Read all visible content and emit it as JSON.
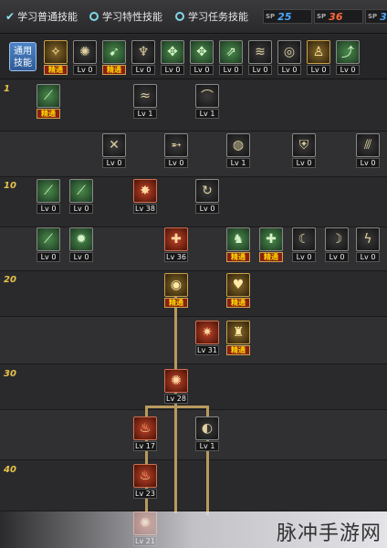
{
  "tabs": [
    {
      "label": "学习普通技能",
      "selected": true
    },
    {
      "label": "学习特性技能",
      "selected": false
    },
    {
      "label": "学习任务技能",
      "selected": false
    }
  ],
  "points": [
    {
      "label": "SP",
      "value": "25",
      "color": "#4aa8ff"
    },
    {
      "label": "SP",
      "value": "36",
      "color": "#ff6a3a"
    },
    {
      "label": "SP",
      "value": "39",
      "color": "#4aa8ff"
    }
  ],
  "common_label": "通用技能",
  "level_markers": [
    "1",
    "10",
    "20",
    "30",
    "40"
  ],
  "common_skills": [
    {
      "icon": "pray-icon",
      "glyph": "✧",
      "color": "gold",
      "label": "精通",
      "master": true
    },
    {
      "icon": "rage-icon",
      "glyph": "✺",
      "color": "dark",
      "label": "Lv 0",
      "master": false
    },
    {
      "icon": "run-icon",
      "glyph": "➹",
      "color": "green",
      "label": "精通",
      "master": true
    },
    {
      "icon": "wing-icon",
      "glyph": "♆",
      "color": "dark",
      "label": "Lv 0",
      "master": false
    },
    {
      "icon": "emblem-icon",
      "glyph": "✥",
      "color": "green",
      "label": "Lv 0",
      "master": false
    },
    {
      "icon": "emblem-icon",
      "glyph": "✥",
      "color": "green",
      "label": "Lv 0",
      "master": false
    },
    {
      "icon": "leap-icon",
      "glyph": "⇗",
      "color": "green",
      "label": "Lv 0",
      "master": false
    },
    {
      "icon": "dash-icon",
      "glyph": "≋",
      "color": "dark",
      "label": "Lv 0",
      "master": false
    },
    {
      "icon": "shield-icon",
      "glyph": "◎",
      "color": "dark",
      "label": "Lv 0",
      "master": false
    },
    {
      "icon": "figure-icon",
      "glyph": "♙",
      "color": "gold",
      "label": "Lv 0",
      "master": false
    },
    {
      "icon": "dodge-icon",
      "glyph": "⤴",
      "color": "green",
      "label": "Lv 0",
      "master": false
    }
  ],
  "skills": [
    {
      "icon": "spear-icon",
      "glyph": "⟋",
      "color": "green",
      "label": "精通",
      "master": true
    },
    {
      "icon": "claw-icon",
      "glyph": "≈",
      "color": "dark",
      "label": "Lv 1",
      "master": false
    },
    {
      "icon": "slash-icon",
      "glyph": "⌒",
      "color": "dark",
      "label": "Lv 1",
      "master": false
    },
    {
      "icon": "cross-slash-icon",
      "glyph": "✕",
      "color": "dark",
      "label": "Lv 0",
      "master": false
    },
    {
      "icon": "arrow-icon",
      "glyph": "➵",
      "color": "dark",
      "label": "Lv 0",
      "master": false
    },
    {
      "icon": "spiral-icon",
      "glyph": "◍",
      "color": "dark",
      "label": "Lv 1",
      "master": false
    },
    {
      "icon": "guard-icon",
      "glyph": "⛨",
      "color": "dark",
      "label": "Lv 0",
      "master": false
    },
    {
      "icon": "triple-slash-icon",
      "glyph": "⫻",
      "color": "dark",
      "label": "Lv 0",
      "master": false
    },
    {
      "icon": "sword-icon",
      "glyph": "⟋",
      "color": "green",
      "label": "Lv 0",
      "master": false
    },
    {
      "icon": "blade-icon",
      "glyph": "⟋",
      "color": "green",
      "label": "Lv 0",
      "master": false
    },
    {
      "icon": "burst-icon",
      "glyph": "✸",
      "color": "red",
      "label": "Lv 38",
      "master": false
    },
    {
      "icon": "swirl-icon",
      "glyph": "↻",
      "color": "dark",
      "label": "Lv 0",
      "master": false
    },
    {
      "icon": "sword-icon",
      "glyph": "⟋",
      "color": "green",
      "label": "Lv 0",
      "master": false
    },
    {
      "icon": "spark-icon",
      "glyph": "✹",
      "color": "green",
      "label": "Lv 0",
      "master": false
    },
    {
      "icon": "strike-icon",
      "glyph": "✚",
      "color": "red",
      "label": "Lv 36",
      "master": false
    },
    {
      "icon": "warrior-icon",
      "glyph": "♞",
      "color": "green",
      "label": "精通",
      "master": true
    },
    {
      "icon": "cross-icon",
      "glyph": "✚",
      "color": "green",
      "label": "精通",
      "master": true
    },
    {
      "icon": "crescent-icon",
      "glyph": "☾",
      "color": "dark",
      "label": "Lv 0",
      "master": false
    },
    {
      "icon": "crescent-icon",
      "glyph": "☽",
      "color": "dark",
      "label": "Lv 0",
      "master": false
    },
    {
      "icon": "lightning-icon",
      "glyph": "ϟ",
      "color": "dark",
      "label": "Lv 0",
      "master": false
    },
    {
      "icon": "shield-icon",
      "glyph": "◉",
      "color": "gold",
      "label": "精通",
      "master": true
    },
    {
      "icon": "heart-icon",
      "glyph": "♥",
      "color": "gold",
      "label": "精通",
      "master": true
    },
    {
      "icon": "impact-icon",
      "glyph": "✷",
      "color": "red",
      "label": "Lv 31",
      "master": false
    },
    {
      "icon": "knight-icon",
      "glyph": "♜",
      "color": "gold",
      "label": "精通",
      "master": true
    },
    {
      "icon": "explosion-icon",
      "glyph": "✺",
      "color": "red",
      "label": "Lv 28",
      "master": false
    },
    {
      "icon": "flame-icon",
      "glyph": "♨",
      "color": "red",
      "label": "Lv 17",
      "master": false
    },
    {
      "icon": "wave-icon",
      "glyph": "◐",
      "color": "dark",
      "label": "Lv 1",
      "master": false
    },
    {
      "icon": "fire-icon",
      "glyph": "♨",
      "color": "red",
      "label": "Lv 23",
      "master": false
    },
    {
      "icon": "blast-icon",
      "glyph": "✺",
      "color": "red",
      "label": "Lv 21",
      "master": false
    }
  ],
  "watermark": "脉冲手游网"
}
